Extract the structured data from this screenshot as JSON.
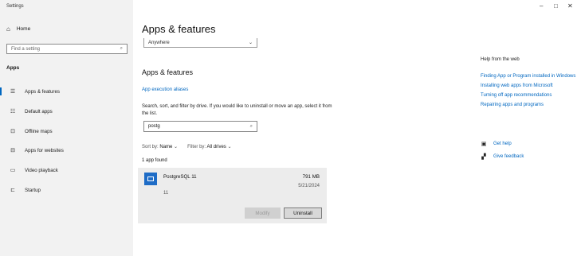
{
  "window": {
    "title": "Settings",
    "minimize": "–",
    "maximize": "□",
    "close": "✕"
  },
  "sidebar": {
    "home_label": "Home",
    "search_placeholder": "Find a setting",
    "section_label": "Apps",
    "items": [
      {
        "label": "Apps & features",
        "icon": "apps-features-icon",
        "glyph": "☰",
        "active": true
      },
      {
        "label": "Default apps",
        "icon": "default-apps-icon",
        "glyph": "☷",
        "active": false
      },
      {
        "label": "Offline maps",
        "icon": "offline-maps-icon",
        "glyph": "⊡",
        "active": false
      },
      {
        "label": "Apps for websites",
        "icon": "apps-for-websites-icon",
        "glyph": "⊟",
        "active": false
      },
      {
        "label": "Video playback",
        "icon": "video-playback-icon",
        "glyph": "▭",
        "active": false
      },
      {
        "label": "Startup",
        "icon": "startup-icon",
        "glyph": "⊏",
        "active": false
      }
    ]
  },
  "main": {
    "title": "Apps & features",
    "source_dropdown": "Anywhere",
    "subtitle": "Apps & features",
    "alias_link": "App execution aliases",
    "description": "Search, sort, and filter by drive. If you would like to uninstall or move an app, select it from the list.",
    "search_value": "postg",
    "sort_label": "Sort by:",
    "sort_value": "Name",
    "filter_label": "Filter by:",
    "filter_value": "All drives",
    "found_text": "1 app found",
    "app": {
      "name": "PostgreSQL 11",
      "size": "791 MB",
      "date": "5/21/2024",
      "version": "11",
      "modify_label": "Modify",
      "uninstall_label": "Uninstall"
    }
  },
  "help": {
    "title": "Help from the web",
    "links": [
      "Finding App or Program installed in Windows",
      "Installing web apps from Microsoft",
      "Turning off app recommendations",
      "Repairing apps and programs"
    ],
    "get_help": "Get help",
    "give_feedback": "Give feedback"
  },
  "colors": {
    "accent": "#0067c0",
    "sidebar_bg": "#f2f2f2",
    "app_icon": "#1e6cc6"
  }
}
